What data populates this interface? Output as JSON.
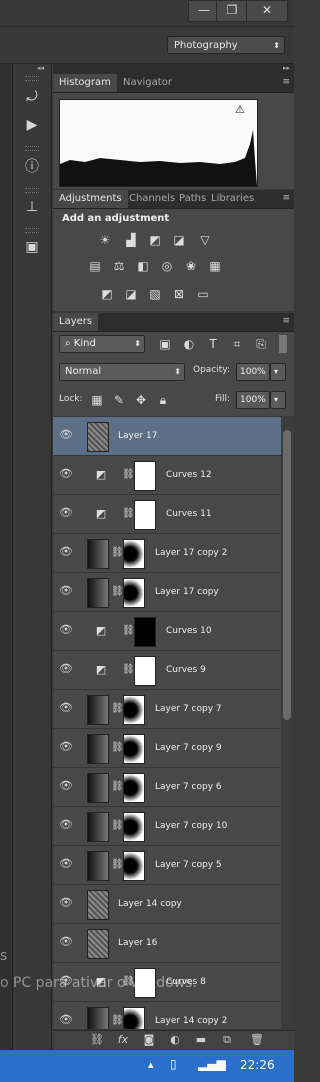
{
  "window": {
    "minimize": "—",
    "restore": "❐",
    "close": "✕"
  },
  "workspace": {
    "value": "Photography"
  },
  "histogram_panel": {
    "tabs": [
      "Histogram",
      "Navigator"
    ],
    "warning": "⚠"
  },
  "adjustments_panel": {
    "tabs": [
      "Adjustments",
      "Channels",
      "Paths",
      "Libraries"
    ],
    "title": "Add an adjustment"
  },
  "layers_panel": {
    "tab": "Layers",
    "filter": "Kind",
    "blend_mode": "Normal",
    "opacity_label": "Opacity:",
    "opacity": "100%",
    "lock_label": "Lock:",
    "fill_label": "Fill:",
    "fill": "100%",
    "layers": [
      {
        "name": "Layer 17",
        "type": "image",
        "selected": true
      },
      {
        "name": "Curves 12",
        "type": "curves"
      },
      {
        "name": "Curves 11",
        "type": "curves"
      },
      {
        "name": "Layer 17 copy 2",
        "type": "masked"
      },
      {
        "name": "Layer 17 copy",
        "type": "masked"
      },
      {
        "name": "Curves 10",
        "type": "curves"
      },
      {
        "name": "Curves 9",
        "type": "curves"
      },
      {
        "name": "Layer 7 copy 7",
        "type": "masked"
      },
      {
        "name": "Layer 7 copy 9",
        "type": "masked"
      },
      {
        "name": "Layer 7 copy 6",
        "type": "masked"
      },
      {
        "name": "Layer 7 copy 10",
        "type": "masked"
      },
      {
        "name": "Layer 7 copy 5",
        "type": "masked"
      },
      {
        "name": "Layer 14 copy",
        "type": "image"
      },
      {
        "name": "Layer 16",
        "type": "image"
      },
      {
        "name": "Curves 8",
        "type": "curves"
      },
      {
        "name": "Layer 14 copy 2",
        "type": "masked"
      }
    ]
  },
  "watermark": {
    "line1": "s",
    "line2": "o PC para ativar o Windows."
  },
  "taskbar": {
    "time": "22:26"
  }
}
